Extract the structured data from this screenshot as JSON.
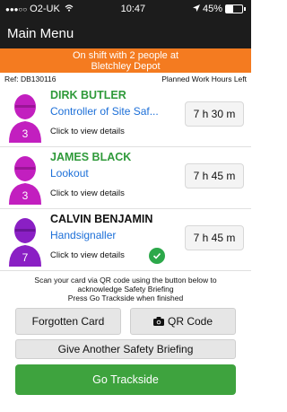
{
  "status": {
    "carrier": "O2-UK",
    "time": "10:47",
    "battery": "45%",
    "battery_level": 0.45
  },
  "nav": {
    "title": "Main Menu"
  },
  "banner": {
    "line1": "On shift with 2 people at",
    "line2": "Bletchley Depot"
  },
  "ref": {
    "label": "Ref: DB130116",
    "hours_header": "Planned Work Hours Left"
  },
  "people": [
    {
      "initial": "3",
      "name": "DIRK BUTLER",
      "role": "Controller of Site Saf...",
      "details": "Click to view details",
      "hours": "7 h 30 m",
      "avatar_color": "#c21fbf"
    },
    {
      "initial": "3",
      "name": "JAMES BLACK",
      "role": "Lookout",
      "details": "Click to view details",
      "hours": "7 h 45 m",
      "avatar_color": "#c21fbf"
    },
    {
      "initial": "7",
      "name": "CALVIN BENJAMIN",
      "role": "Handsignaller",
      "details": "Click to view details",
      "hours": "7 h 45 m",
      "avatar_color": "#8a1fc4"
    }
  ],
  "instructions": {
    "line1": "Scan your card via QR code using the button below to",
    "line2": "acknowledge Safety Briefing",
    "line3": "Press Go Trackside when finished"
  },
  "buttons": {
    "forgotten": "Forgotten Card",
    "qr": "QR Code",
    "briefing": "Give Another Safety Briefing",
    "trackside": "Go Trackside"
  },
  "colors": {
    "orange": "#f47b20",
    "green": "#3ea33e",
    "blue": "#1c6fd8",
    "dark": "#1c1c1c"
  }
}
